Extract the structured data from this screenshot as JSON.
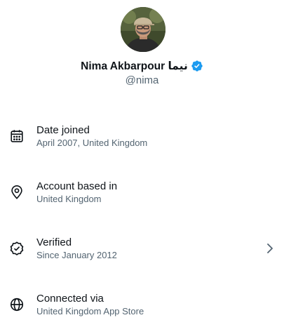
{
  "profile": {
    "name": "Nima Akbarpour نیما",
    "handle": "@nima",
    "verified_color": "#1d9bf0"
  },
  "items": [
    {
      "icon": "calendar-icon",
      "title": "Date joined",
      "subtitle": "April 2007, United Kingdom"
    },
    {
      "icon": "location-pin-icon",
      "title": "Account based in",
      "subtitle": "United Kingdom"
    },
    {
      "icon": "verified-badge-outline-icon",
      "title": "Verified",
      "subtitle": "Since January 2012",
      "has_chevron": true
    },
    {
      "icon": "globe-icon",
      "title": "Connected via",
      "subtitle": "United Kingdom App Store"
    }
  ],
  "colors": {
    "text_primary": "#0f1419",
    "text_secondary": "#536471",
    "accent": "#1d9bf0"
  }
}
